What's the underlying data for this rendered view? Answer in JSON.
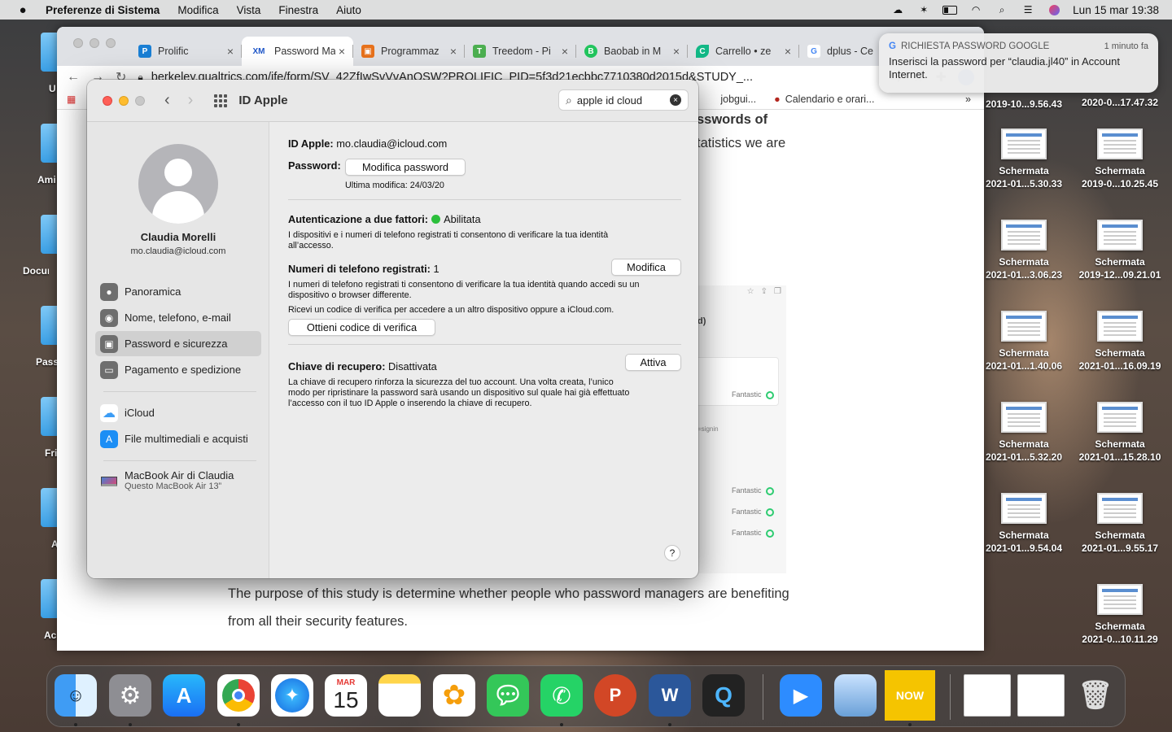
{
  "menubar": {
    "app": "Preferenze di Sistema",
    "items": [
      "Modifica",
      "Vista",
      "Finestra",
      "Aiuto"
    ],
    "clock": "Lun 15 mar  19:38"
  },
  "desktop_left": [
    {
      "label": "U"
    },
    {
      "label": "Ami"
    },
    {
      "label": "Docum"
    },
    {
      "label": "Pass"
    },
    {
      "label": "Fri"
    },
    {
      "label": "A"
    },
    {
      "label": "Ac"
    }
  ],
  "desktop_right": [
    {
      "l1": "2019-10...9.56.43",
      "l2": ""
    },
    {
      "l1": "2020-0...17.47.32",
      "l2": ""
    },
    {
      "l1": "Schermata",
      "l2": "2021-01...5.30.33"
    },
    {
      "l1": "Schermata",
      "l2": "2019-0...10.25.45"
    },
    {
      "l1": "Schermata",
      "l2": "2021-01...3.06.23"
    },
    {
      "l1": "Schermata",
      "l2": "2019-12...09.21.01"
    },
    {
      "l1": "Schermata",
      "l2": "2021-01...1.40.06"
    },
    {
      "l1": "Schermata",
      "l2": "2021-01...16.09.19"
    },
    {
      "l1": "Schermata",
      "l2": "2021-01...5.32.20"
    },
    {
      "l1": "Schermata",
      "l2": "2021-01...15.28.10"
    },
    {
      "l1": "Schermata",
      "l2": "2021-01...9.54.04"
    },
    {
      "l1": "Schermata",
      "l2": "2021-01...9.55.17"
    },
    {
      "l1": "Schermata",
      "l2": "2021-0...10.11.29"
    }
  ],
  "browser": {
    "tabs": [
      {
        "title": "Prolific",
        "fav": "P",
        "color": "#1a7fd4"
      },
      {
        "title": "Password Ma",
        "fav": "XM",
        "color": "#1e56c8"
      },
      {
        "title": "Programmaz",
        "fav": "▣",
        "color": "#e7711b"
      },
      {
        "title": "Treedom - Pi",
        "fav": "T",
        "color": "#4caf50"
      },
      {
        "title": "Baobab in M",
        "fav": "B",
        "color": "#22c55e"
      },
      {
        "title": "Carrello • ze",
        "fav": "C",
        "color": "#12b886"
      },
      {
        "title": "dplus - Ce",
        "fav": "G",
        "color": "#4285f4"
      }
    ],
    "url": "berkeley.qualtrics.com/jfe/form/SV_42ZfIwSvVvAnQSW?PROLIFIC_PID=5f3d21ecbbc7710380d2015d&STUDY_...",
    "bookmarks": [
      "jobgui...",
      "Calendario e orari..."
    ],
    "bookmarks_more": "»",
    "page_fragment1": "sswords of",
    "page_fragment2": "tatistics we are",
    "page_fragment3": "d)",
    "page_fragment4": "=signin",
    "fantastic": "Fantastic",
    "page_text1": "The purpose of this study is determine whether people who password managers are benefiting",
    "page_text2": "from all their security features."
  },
  "notification": {
    "app": "RICHIESTA PASSWORD GOOGLE",
    "time": "1 minuto fa",
    "body": "Inserisci la password per “claudia.jl40” in Account Internet."
  },
  "prefs": {
    "title": "ID Apple",
    "search": "apple id cloud",
    "user_name": "Claudia Morelli",
    "user_email": "mo.claudia@icloud.com",
    "sidebar": [
      {
        "label": "Panoramica",
        "icon": "apple-icon",
        "color": "#7a7a7a",
        "glyph": ""
      },
      {
        "label": "Nome, telefono, e-mail",
        "icon": "person-icon",
        "color": "#7a7a7a",
        "glyph": "◉"
      },
      {
        "label": "Password e sicurezza",
        "icon": "lock-icon",
        "color": "#7a7a7a",
        "glyph": "🔒︎"
      },
      {
        "label": "Pagamento e spedizione",
        "icon": "card-icon",
        "color": "#7a7a7a",
        "glyph": "▭"
      },
      {
        "label": "iCloud",
        "icon": "cloud-icon",
        "color": "#3b9cf5",
        "glyph": "☁"
      },
      {
        "label": "File multimediali e acquisti",
        "icon": "appstore-icon",
        "color": "#1c8ef5",
        "glyph": "A"
      }
    ],
    "device_name": "MacBook Air di Claudia",
    "device_sub": "Questo MacBook Air 13”",
    "appleid_label": "ID Apple:",
    "appleid_value": "mo.claudia@icloud.com",
    "password_label": "Password:",
    "change_pw_btn": "Modifica password",
    "last_change": "Ultima modifica: 24/03/20",
    "twofa_label": "Autenticazione a due fattori:",
    "twofa_value": "Abilitata",
    "twofa_desc1": "I dispositivi e i numeri di telefono registrati ti consentono di verificare la tua identità",
    "twofa_desc2": "all’accesso.",
    "phones_label": "Numeri di telefono registrati:",
    "phones_value": "1",
    "modify_btn": "Modifica",
    "phones_desc1": "I numeri di telefono registrati ti consentono di verificare la tua identità quando accedi su un",
    "phones_desc2": "dispositivo o browser differente.",
    "code_desc": "Ricevi un codice di verifica per accedere a un altro dispositivo oppure a iCloud.com.",
    "code_btn": "Ottieni codice di verifica",
    "recovery_label": "Chiave di recupero:",
    "recovery_value": "Disattivata",
    "activate_btn": "Attiva",
    "recovery_desc1": "La chiave di recupero rinforza la sicurezza del tuo account. Una volta creata, l’unico",
    "recovery_desc2": "modo per ripristinare la password sarà usando un dispositivo sul quale hai già effettuato",
    "recovery_desc3": "l’accesso con il tuo ID Apple o inserendo la chiave di recupero.",
    "help": "?"
  },
  "dock": {
    "calendar_month": "MAR",
    "calendar_day": "15",
    "nowtv": "NOW",
    "ppt": "P",
    "word": "W"
  }
}
